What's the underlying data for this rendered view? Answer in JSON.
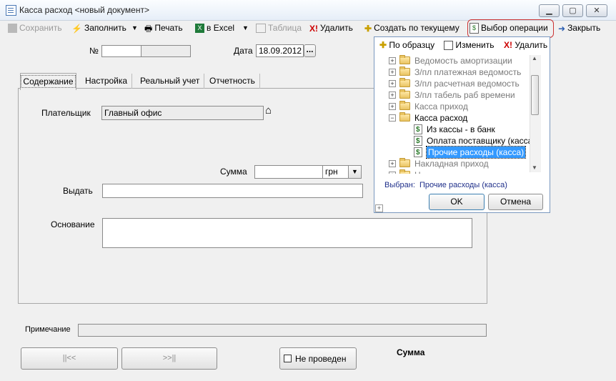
{
  "window": {
    "title": "Касса расход <новый документ>"
  },
  "toolbar": {
    "save": "Сохранить",
    "fill": "Заполнить",
    "print": "Печать",
    "excel": "в Excel",
    "table": "Таблица",
    "delete": "Удалить",
    "create_from": "Создать по текущему",
    "select_operation": "Выбор операции",
    "close": "Закрыть"
  },
  "header": {
    "number_label": "№",
    "number_value": "",
    "date_label": "Дата",
    "date_value": "18.09.2012",
    "date_button": "..."
  },
  "tabs": [
    "Содержание",
    "Настройка",
    "Реальный учет",
    "Отчетность"
  ],
  "form": {
    "payer_label": "Плательщик",
    "payer_value": "Главный офис",
    "sum_label": "Сумма",
    "sum_value": "",
    "currency": "грн",
    "issue_label": "Выдать",
    "issue_value": "",
    "basis_label": "Основание",
    "basis_value": ""
  },
  "footer": {
    "note_label": "Примечание",
    "note_value": "",
    "prev_button": "||<<",
    "next_button": ">>||",
    "not_posted": "Не проведен",
    "sum_caption": "Сумма"
  },
  "popup": {
    "by_sample": "По образцу",
    "edit": "Изменить",
    "delete": "Удалить",
    "tree": [
      {
        "label": "Ведомость амортизации",
        "level": 0,
        "type": "folder",
        "expander": "+",
        "dim": true
      },
      {
        "label": "З/пл платежная ведомость",
        "level": 0,
        "type": "folder",
        "expander": "+",
        "dim": true
      },
      {
        "label": "З/пл расчетная ведомость",
        "level": 0,
        "type": "folder",
        "expander": "+",
        "dim": true
      },
      {
        "label": "З/пл табель раб времени",
        "level": 0,
        "type": "folder",
        "expander": "+",
        "dim": true
      },
      {
        "label": "Касса приход",
        "level": 0,
        "type": "folder",
        "expander": "+",
        "dim": true
      },
      {
        "label": "Касса расход",
        "level": 0,
        "type": "folder",
        "expander": "−",
        "dim": false
      },
      {
        "label": "Из кассы - в банк",
        "level": 1,
        "type": "doc",
        "expander": "",
        "dim": false
      },
      {
        "label": "Оплата поставщику (касса)",
        "level": 1,
        "type": "doc",
        "expander": "",
        "dim": false
      },
      {
        "label": "Прочие расходы (касса)",
        "level": 1,
        "type": "doc",
        "expander": "",
        "dim": false,
        "selected": true
      },
      {
        "label": "Накладная приход",
        "level": 0,
        "type": "folder",
        "expander": "+",
        "dim": true
      },
      {
        "label": "Н",
        "level": 0,
        "type": "folder",
        "expander": "+",
        "dim": true
      }
    ],
    "selected_label": "Выбран:",
    "selected_value": "Прочие расходы (касса)",
    "ok": "OK",
    "cancel": "Отмена"
  },
  "colors": {
    "selection": "#3399ff",
    "selected_text_caption": "#1f2f8a",
    "highlight_border": "#cc3333"
  }
}
